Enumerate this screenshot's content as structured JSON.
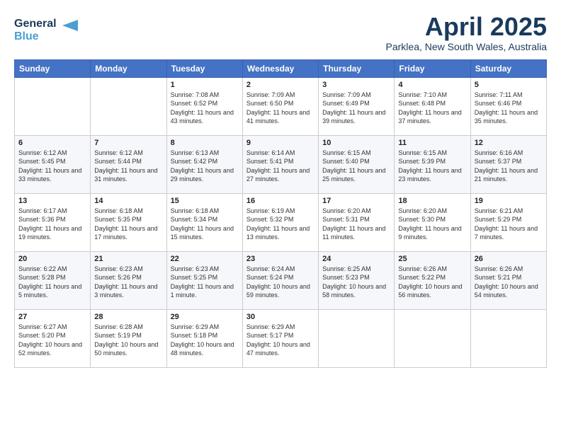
{
  "logo": {
    "line1": "General",
    "line2": "Blue"
  },
  "title": "April 2025",
  "location": "Parklea, New South Wales, Australia",
  "weekdays": [
    "Sunday",
    "Monday",
    "Tuesday",
    "Wednesday",
    "Thursday",
    "Friday",
    "Saturday"
  ],
  "weeks": [
    [
      {
        "day": "",
        "info": ""
      },
      {
        "day": "",
        "info": ""
      },
      {
        "day": "1",
        "info": "Sunrise: 7:08 AM\nSunset: 6:52 PM\nDaylight: 11 hours and 43 minutes."
      },
      {
        "day": "2",
        "info": "Sunrise: 7:09 AM\nSunset: 6:50 PM\nDaylight: 11 hours and 41 minutes."
      },
      {
        "day": "3",
        "info": "Sunrise: 7:09 AM\nSunset: 6:49 PM\nDaylight: 11 hours and 39 minutes."
      },
      {
        "day": "4",
        "info": "Sunrise: 7:10 AM\nSunset: 6:48 PM\nDaylight: 11 hours and 37 minutes."
      },
      {
        "day": "5",
        "info": "Sunrise: 7:11 AM\nSunset: 6:46 PM\nDaylight: 11 hours and 35 minutes."
      }
    ],
    [
      {
        "day": "6",
        "info": "Sunrise: 6:12 AM\nSunset: 5:45 PM\nDaylight: 11 hours and 33 minutes."
      },
      {
        "day": "7",
        "info": "Sunrise: 6:12 AM\nSunset: 5:44 PM\nDaylight: 11 hours and 31 minutes."
      },
      {
        "day": "8",
        "info": "Sunrise: 6:13 AM\nSunset: 5:42 PM\nDaylight: 11 hours and 29 minutes."
      },
      {
        "day": "9",
        "info": "Sunrise: 6:14 AM\nSunset: 5:41 PM\nDaylight: 11 hours and 27 minutes."
      },
      {
        "day": "10",
        "info": "Sunrise: 6:15 AM\nSunset: 5:40 PM\nDaylight: 11 hours and 25 minutes."
      },
      {
        "day": "11",
        "info": "Sunrise: 6:15 AM\nSunset: 5:39 PM\nDaylight: 11 hours and 23 minutes."
      },
      {
        "day": "12",
        "info": "Sunrise: 6:16 AM\nSunset: 5:37 PM\nDaylight: 11 hours and 21 minutes."
      }
    ],
    [
      {
        "day": "13",
        "info": "Sunrise: 6:17 AM\nSunset: 5:36 PM\nDaylight: 11 hours and 19 minutes."
      },
      {
        "day": "14",
        "info": "Sunrise: 6:18 AM\nSunset: 5:35 PM\nDaylight: 11 hours and 17 minutes."
      },
      {
        "day": "15",
        "info": "Sunrise: 6:18 AM\nSunset: 5:34 PM\nDaylight: 11 hours and 15 minutes."
      },
      {
        "day": "16",
        "info": "Sunrise: 6:19 AM\nSunset: 5:32 PM\nDaylight: 11 hours and 13 minutes."
      },
      {
        "day": "17",
        "info": "Sunrise: 6:20 AM\nSunset: 5:31 PM\nDaylight: 11 hours and 11 minutes."
      },
      {
        "day": "18",
        "info": "Sunrise: 6:20 AM\nSunset: 5:30 PM\nDaylight: 11 hours and 9 minutes."
      },
      {
        "day": "19",
        "info": "Sunrise: 6:21 AM\nSunset: 5:29 PM\nDaylight: 11 hours and 7 minutes."
      }
    ],
    [
      {
        "day": "20",
        "info": "Sunrise: 6:22 AM\nSunset: 5:28 PM\nDaylight: 11 hours and 5 minutes."
      },
      {
        "day": "21",
        "info": "Sunrise: 6:23 AM\nSunset: 5:26 PM\nDaylight: 11 hours and 3 minutes."
      },
      {
        "day": "22",
        "info": "Sunrise: 6:23 AM\nSunset: 5:25 PM\nDaylight: 11 hours and 1 minute."
      },
      {
        "day": "23",
        "info": "Sunrise: 6:24 AM\nSunset: 5:24 PM\nDaylight: 10 hours and 59 minutes."
      },
      {
        "day": "24",
        "info": "Sunrise: 6:25 AM\nSunset: 5:23 PM\nDaylight: 10 hours and 58 minutes."
      },
      {
        "day": "25",
        "info": "Sunrise: 6:26 AM\nSunset: 5:22 PM\nDaylight: 10 hours and 56 minutes."
      },
      {
        "day": "26",
        "info": "Sunrise: 6:26 AM\nSunset: 5:21 PM\nDaylight: 10 hours and 54 minutes."
      }
    ],
    [
      {
        "day": "27",
        "info": "Sunrise: 6:27 AM\nSunset: 5:20 PM\nDaylight: 10 hours and 52 minutes."
      },
      {
        "day": "28",
        "info": "Sunrise: 6:28 AM\nSunset: 5:19 PM\nDaylight: 10 hours and 50 minutes."
      },
      {
        "day": "29",
        "info": "Sunrise: 6:29 AM\nSunset: 5:18 PM\nDaylight: 10 hours and 48 minutes."
      },
      {
        "day": "30",
        "info": "Sunrise: 6:29 AM\nSunset: 5:17 PM\nDaylight: 10 hours and 47 minutes."
      },
      {
        "day": "",
        "info": ""
      },
      {
        "day": "",
        "info": ""
      },
      {
        "day": "",
        "info": ""
      }
    ]
  ]
}
